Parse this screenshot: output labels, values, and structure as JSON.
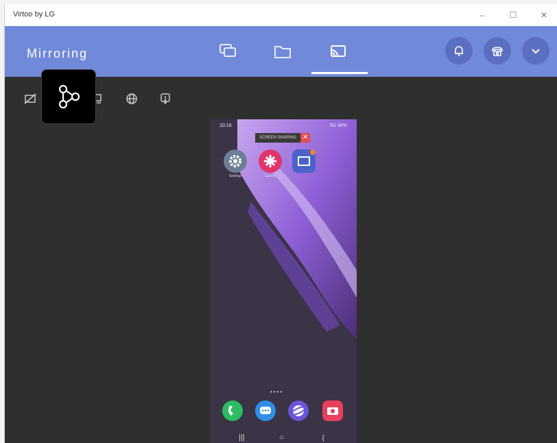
{
  "window": {
    "title": "Virtoo by LG"
  },
  "header": {
    "title": "Mirroring"
  },
  "phone": {
    "status_time": "10:16",
    "status_right": "5G 36%",
    "screen_sharing": "SCREEN SHARING",
    "apps": [
      {
        "label": "Settings"
      },
      {
        "label": "Gallery"
      },
      {
        "label": ""
      }
    ]
  }
}
